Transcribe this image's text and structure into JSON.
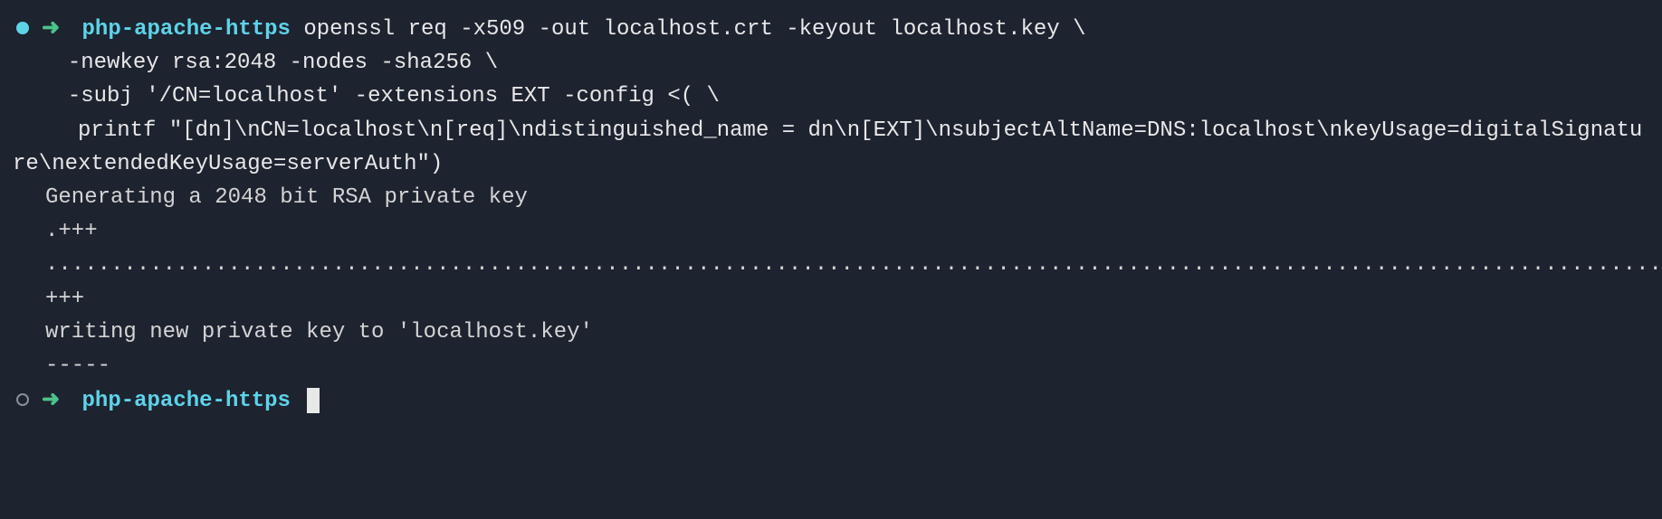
{
  "prompt1": {
    "arrow": "➜",
    "dir": "php-apache-https",
    "cmd_line1": "openssl req -x509 -out localhost.crt -keyout localhost.key \\",
    "cmd_line2": "  -newkey rsa:2048 -nodes -sha256 \\",
    "cmd_line3": "  -subj '/CN=localhost' -extensions EXT -config <( \\",
    "cmd_line4": "   printf \"[dn]\\nCN=localhost\\n[req]\\ndistinguished_name = dn\\n[EXT]\\nsubjectAltName=DNS:localhost\\nkeyUsage=digitalSignature\\nextendedKeyUsage=serverAuth\")"
  },
  "output": {
    "line1": "Generating a 2048 bit RSA private key",
    "line2": ".+++",
    "line3": ".............................................................................................................................................+++",
    "line4": "writing new private key to 'localhost.key'",
    "line5": "-----"
  },
  "prompt2": {
    "arrow": "➜",
    "dir": "php-apache-https"
  }
}
